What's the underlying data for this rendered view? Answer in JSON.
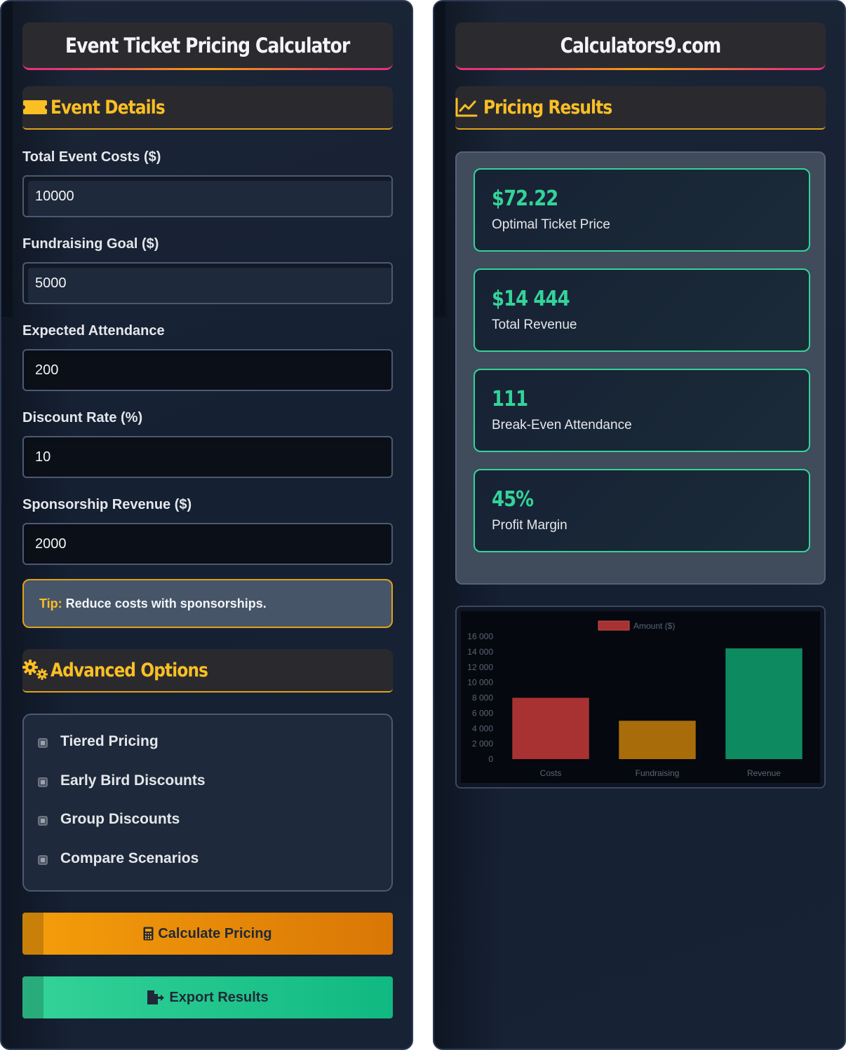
{
  "left": {
    "title": "Event Ticket Pricing Calculator",
    "event_details": {
      "heading": "Event Details",
      "fields": [
        {
          "label": "Total Event Costs ($)",
          "value": "10000"
        },
        {
          "label": "Fundraising Goal ($)",
          "value": "5000"
        },
        {
          "label": "Expected Attendance",
          "value": "200"
        },
        {
          "label": "Discount Rate (%)",
          "value": "10"
        },
        {
          "label": "Sponsorship Revenue ($)",
          "value": "2000"
        }
      ]
    },
    "tip": {
      "prefix": "Tip:",
      "text": "Reduce costs with sponsorships."
    },
    "advanced": {
      "heading": "Advanced Options",
      "options": [
        "Tiered Pricing",
        "Early Bird Discounts",
        "Group Discounts",
        "Compare Scenarios"
      ]
    },
    "buttons": {
      "calculate": "Calculate Pricing",
      "export": "Export Results"
    }
  },
  "right": {
    "title": "Calculators9.com",
    "heading": "Pricing Results",
    "results": [
      {
        "value": "$72.22",
        "label": "Optimal Ticket Price"
      },
      {
        "value": "$14 444",
        "label": "Total Revenue"
      },
      {
        "value": "111",
        "label": "Break-Even Attendance"
      },
      {
        "value": "45%",
        "label": "Profit Margin"
      }
    ]
  },
  "colors": {
    "accent": "#fbbf24",
    "success": "#34d399",
    "danger": "#a83232"
  },
  "chart_data": {
    "type": "bar",
    "categories": [
      "Costs",
      "Fundraising",
      "Revenue"
    ],
    "series": [
      {
        "name": "Amount ($)",
        "values": [
          8000,
          5000,
          14444
        ],
        "colors": [
          "#a83232",
          "#a86d0a",
          "#0e8a60"
        ]
      }
    ],
    "ylim": [
      0,
      16000
    ],
    "yticks": [
      "0",
      "2 000",
      "4 000",
      "6 000",
      "8 000",
      "10 000",
      "12 000",
      "14 000",
      "16 000"
    ],
    "legend": "top"
  }
}
